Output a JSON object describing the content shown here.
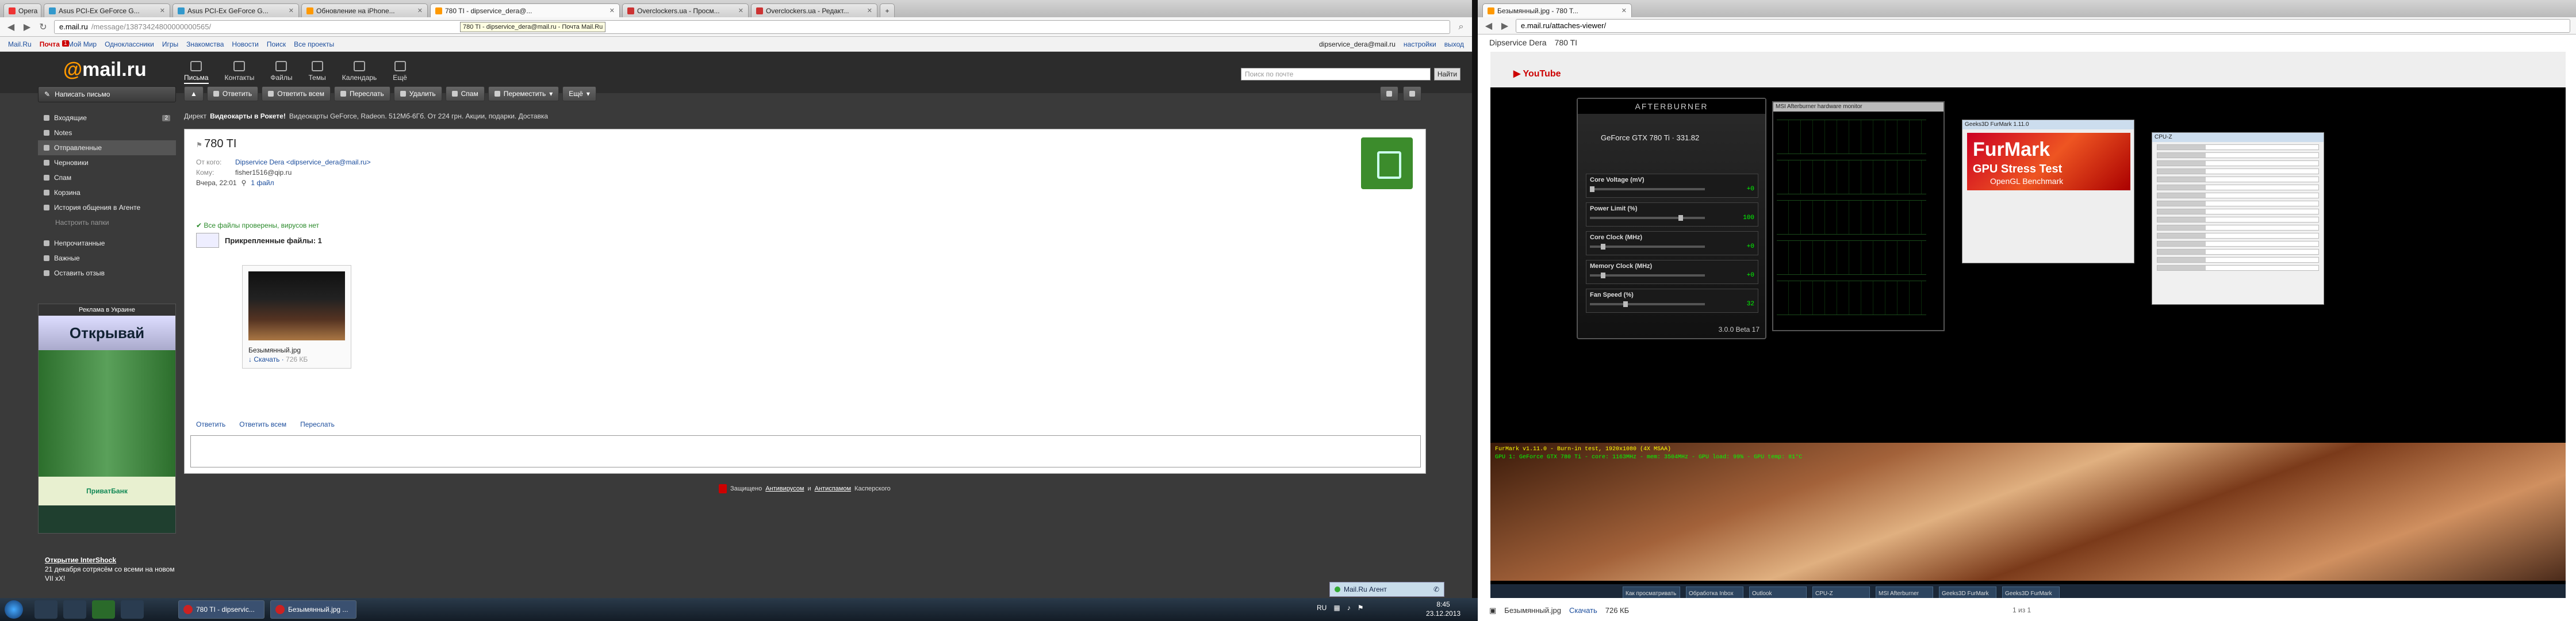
{
  "left_browser": {
    "tabs": [
      {
        "label": "Opera"
      },
      {
        "label": "Asus PCI-Ex GeForce G..."
      },
      {
        "label": "Asus PCI-Ex GeForce G..."
      },
      {
        "label": "Обновление на iPhone..."
      },
      {
        "label": "780 TI - dipservice_dera@..."
      },
      {
        "label": "Overclockers.ua - Просм..."
      },
      {
        "label": "Overclockers.ua - Редакт..."
      }
    ],
    "tooltip": "780 TI - dipservice_dera@mail.ru - Почта Mail.Ru",
    "url_host": "e.mail.ru",
    "url_path": "/message/13873424800000000565/",
    "top_links": [
      "Mail.Ru",
      "Почта",
      "Мой Мир",
      "Одноклассники",
      "Игры",
      "Знакомства",
      "Новости",
      "Поиск",
      "Все проекты"
    ],
    "top_counter": "1",
    "user_email": "dipservice_dera@mail.ru",
    "settings_link": "настройки",
    "exit_link": "выход",
    "logo_at": "@",
    "logo_text": "mail.ru",
    "header_nav": [
      "Письма",
      "Контакты",
      "Файлы",
      "Темы",
      "Календарь",
      "Ещё"
    ],
    "search_placeholder": "Поиск по почте",
    "search_button": "Найти",
    "compose": "Написать письмо",
    "folders": [
      {
        "label": "Входящие",
        "count": "2"
      },
      {
        "label": "Notes",
        "count": ""
      },
      {
        "label": "Отправленные",
        "count": ""
      },
      {
        "label": "Черновики",
        "count": ""
      },
      {
        "label": "Спам",
        "count": ""
      },
      {
        "label": "Корзина",
        "count": ""
      },
      {
        "label": "История общения в Агенте",
        "count": ""
      }
    ],
    "folders_sub": "Настроить папки",
    "folders2": [
      {
        "label": "Непрочитанные"
      },
      {
        "label": "Важные"
      },
      {
        "label": "Оставить отзыв"
      }
    ],
    "ad_title": "Реклама в Украине",
    "ad_big": "Открывай",
    "ad_logo": "ПриватБанк",
    "promo_title": "Открытие InterShock",
    "promo_text": "21 декабря сотрясём со всеми на новом VII хХ!",
    "toolbar": [
      "Ответить",
      "Ответить всем",
      "Переслать",
      "Удалить",
      "Спам",
      "Переместить",
      "Ещё"
    ],
    "breadcrumb_label": "Директ",
    "breadcrumb_text": "Видеокарты в Рокете!",
    "breadcrumb_rest": "Видеокарты GeForce, Radeon. 512Мб-6Гб. От 224 грн. Акции, подарки. Доставка",
    "subject": "780 TI",
    "from_label": "От кого:",
    "from_value": "Dipservice Dera <dipservice_dera@mail.ru>",
    "to_label": "Кому:",
    "to_value": "fisher1516@qip.ru",
    "date_label": "Вчера, 22:01",
    "files_link": "1 файл",
    "virus_check": "Все файлы проверены, вирусов нет",
    "attached_label": "Прикрепленные файлы: 1",
    "file_name": "Безымянный.jpg",
    "file_download": "Скачать",
    "file_size": "726 КБ",
    "reply": "Ответить",
    "reply_all": "Ответить всем",
    "forward": "Переслать",
    "footer_prefix": "Защищено",
    "footer_link1": "Антивирусом",
    "footer_and": "и",
    "footer_link2": "Антиспамом",
    "footer_suffix": "Касперского",
    "agent": "Mail.Ru Агент"
  },
  "right_browser": {
    "title_user": "Dipservice Dera",
    "title_subject": "780 TI",
    "window_tab": "Безымянный.jpg - 780 T...",
    "window_url": "e.mail.ru/attaches-viewer/",
    "ab_title": "AFTERBURNER",
    "ab_gpu": "GeForce GTX 780 Ti",
    "ab_driver": "331.82",
    "ab_sliders": [
      {
        "label": "Core Voltage (mV)",
        "value": "+0",
        "level": 0.0
      },
      {
        "label": "Power Limit (%)",
        "value": "100",
        "level": 0.8
      },
      {
        "label": "Core Clock (MHz)",
        "value": "+0",
        "level": 0.1
      },
      {
        "label": "Memory Clock (MHz)",
        "value": "+0",
        "level": 0.1
      },
      {
        "label": "Fan Speed (%)",
        "value": "32",
        "level": 0.3
      }
    ],
    "ab_version": "3.0.0 Beta 17",
    "mon_title": "MSI Afterburner hardware monitor",
    "fm_title": "Geeks3D FurMark 1.11.0",
    "fm_logo1": "FurMark",
    "fm_logo2": "GPU Stress Test",
    "fm_logo3": "OpenGL Benchmark",
    "gz_title": "CPU-Z",
    "render_info": "FurMark v1.11.0 - Burn-in test, 1920x1080 (4X MSAA)",
    "render_info2": "GPU 1: GeForce GTX 780 Ti - core: 1163MHz - mem: 3504MHz - GPU load: 99% - GPU temp: 81°C",
    "vtask": [
      "Как просматривать",
      "Обработка Inbox",
      "Outlook",
      "CPU-Z",
      "MSI Afterburner",
      "Geeks3D FurMark",
      "Geeks3D FurMark"
    ],
    "bottom_name": "Безымянный.jpg",
    "bottom_dl": "Скачать",
    "bottom_size": "726 КБ",
    "pager": "1 из 1"
  },
  "taskbar": {
    "windows": [
      {
        "label": "780 TI - dipservic..."
      },
      {
        "label": "Безымянный.jpg ..."
      }
    ],
    "lang": "RU",
    "time": "8:45",
    "date": "23.12.2013"
  }
}
